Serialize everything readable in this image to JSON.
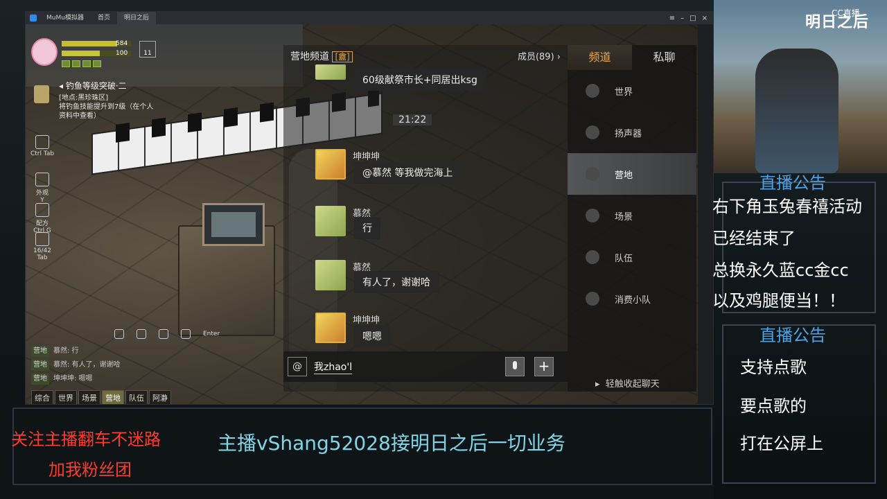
{
  "emulator": {
    "app_name": "MuMu模拟器",
    "tab_home": "首页",
    "tab_game": "明日之后"
  },
  "hud": {
    "hp": "584",
    "mp": "100",
    "level_badge": "11",
    "hp_fraction": 0.8,
    "mp_fraction": 0.55
  },
  "quest": {
    "title": "钓鱼等级突破·二",
    "body_line1": "[地点:黑珍珠区]",
    "body_line2": "将钓鱼技能提升到7级（在个人",
    "body_line3": "资料中查看）"
  },
  "side_buttons": [
    {
      "label": "Ctrl Tab"
    },
    {
      "label": "外观"
    },
    {
      "label": "Y"
    },
    {
      "label": "配方"
    },
    {
      "label": "Ctrl G"
    },
    {
      "label": "16/42"
    },
    {
      "label": "Tab"
    }
  ],
  "voice_row": {
    "enter": "Enter"
  },
  "mini_chat": {
    "lines": [
      {
        "tag": "营地",
        "text": "慕然: 行"
      },
      {
        "tag": "营地",
        "text": "慕然: 有人了，谢谢哈"
      },
      {
        "tag": "营地",
        "text": "坤坤坤: 嗯嗯"
      }
    ],
    "tabs": [
      "综合",
      "世界",
      "场景",
      "营地",
      "队伍",
      "阿瀞"
    ]
  },
  "chat": {
    "title": "营地频道",
    "title_badge": "[盦]",
    "members": "成员(89)",
    "timestamp": "21:22",
    "messages": [
      {
        "nick": "",
        "text": "60级献祭市长+同居出ksg"
      },
      {
        "nick": "坤坤坤",
        "text": "@慕然 等我做完海上"
      },
      {
        "nick": "慕然",
        "text": "行"
      },
      {
        "nick": "慕然",
        "text": "有人了，谢谢哈"
      },
      {
        "nick": "坤坤坤",
        "text": "嗯嗯"
      }
    ],
    "input_at": "@",
    "input_value": "我zhao'l",
    "plus": "+"
  },
  "channels": {
    "tab_channel": "频道",
    "tab_private": "私聊",
    "items": [
      "世界",
      "扬声器",
      "营地",
      "场景",
      "队伍",
      "消费小队"
    ],
    "fold": "轻触收起聊天"
  },
  "stream": {
    "logo": "明日之后",
    "cc": "CC直播",
    "notice1_title": "直播公告",
    "notice1_lines": [
      "右下角玉兔春禧活动",
      "已经结束了",
      "总换永久蓝cc金cc",
      "以及鸡腿便当！！"
    ],
    "notice2_title": "直播公告",
    "notice2_lines": [
      "支持点歌",
      "要点歌的",
      "打在公屏上"
    ],
    "follow_line1": "关注主播翻车不迷路",
    "follow_line2": "加我粉丝团",
    "business": "主播vShang52028接明日之后一切业务"
  }
}
